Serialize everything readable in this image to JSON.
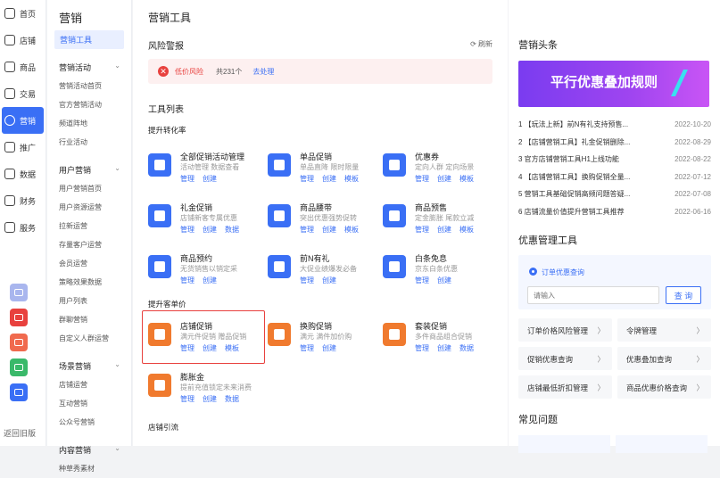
{
  "nav": {
    "items": [
      {
        "label": "首页"
      },
      {
        "label": "店铺"
      },
      {
        "label": "商品"
      },
      {
        "label": "交易"
      },
      {
        "label": "营销"
      },
      {
        "label": "推广"
      },
      {
        "label": "数据"
      },
      {
        "label": "财务"
      },
      {
        "label": "服务"
      }
    ],
    "back": "返回旧版"
  },
  "apps": [
    {
      "name": "chart-app-icon",
      "color": "#a9b6ee"
    },
    {
      "name": "video-app-icon",
      "color": "#e8413e"
    },
    {
      "name": "card-app-icon",
      "color": "#f06a4e"
    },
    {
      "name": "mail-app-icon",
      "color": "#3ab96a"
    },
    {
      "name": "grid-app-icon",
      "color": "#3a6ff5"
    }
  ],
  "sub": {
    "title": "营销",
    "selected": "营销工具",
    "groups": [
      {
        "title": "营销活动",
        "items": [
          "营销活动首页",
          "官方营销活动",
          "频道阵地",
          "行业活动"
        ]
      },
      {
        "title": "用户营销",
        "items": [
          "用户营销首页",
          "用户资源运营",
          "拉新运营",
          "存量客户运营",
          "会员运营",
          "策略效果数据",
          "用户列表",
          "群聊营销",
          "自定义人群运营"
        ]
      },
      {
        "title": "场景营销",
        "items": [
          "店铺运营",
          "互动营销",
          "公众号营销"
        ]
      },
      {
        "title": "内容营销",
        "items": [
          "种草秀素材"
        ]
      }
    ]
  },
  "main": {
    "title": "营销工具",
    "risk_title": "风险警报",
    "refresh": "刷新",
    "risk": {
      "icon": "✕",
      "label": "低价风险",
      "count": "共231个",
      "action": "去处理"
    },
    "tools_title": "工具列表"
  },
  "categories": [
    {
      "label": "提升转化率"
    },
    {
      "label": "提升客单价"
    },
    {
      "label": "店铺引流"
    }
  ],
  "tools": [
    {
      "name": "全部促销活动管理",
      "desc": "活动管理 数据查看",
      "actions": [
        "管理",
        "创建"
      ],
      "color": "#3a6ff5"
    },
    {
      "name": "单品促销",
      "desc": "单品直降 限时限量",
      "actions": [
        "管理",
        "创建",
        "模板"
      ],
      "color": "#3a6ff5"
    },
    {
      "name": "优惠券",
      "desc": "定向人群 定向场景",
      "actions": [
        "管理",
        "创建",
        "模板"
      ],
      "color": "#3a6ff5"
    },
    {
      "name": "礼金促销",
      "desc": "店铺新客专属优惠",
      "actions": [
        "管理",
        "创建",
        "数据"
      ],
      "color": "#3a6ff5"
    },
    {
      "name": "商品腰带",
      "desc": "突出优惠强势促转",
      "actions": [
        "管理",
        "创建",
        "模板"
      ],
      "color": "#3a6ff5"
    },
    {
      "name": "商品预售",
      "desc": "定金膨胀 尾款立减",
      "actions": [
        "管理",
        "创建",
        "模板"
      ],
      "color": "#3a6ff5"
    },
    {
      "name": "商品预约",
      "desc": "无货销售以销定采",
      "actions": [
        "管理",
        "创建"
      ],
      "color": "#3a6ff5"
    },
    {
      "name": "前N有礼",
      "desc": "大促业绩爆发必备",
      "actions": [
        "管理",
        "创建"
      ],
      "color": "#3a6ff5"
    },
    {
      "name": "白条免息",
      "desc": "京东白条优惠",
      "actions": [
        "管理",
        "创建"
      ],
      "color": "#3a6ff5"
    },
    {
      "name": "店铺促销",
      "desc": "满元件促销 赠品促销",
      "actions": [
        "管理",
        "创建",
        "模板"
      ],
      "color": "#f07a2e"
    },
    {
      "name": "换购促销",
      "desc": "满元 满件加价购",
      "actions": [
        "管理",
        "创建"
      ],
      "color": "#f07a2e"
    },
    {
      "name": "套装促销",
      "desc": "多件商品组合促销",
      "actions": [
        "管理",
        "创建",
        "数据"
      ],
      "color": "#f07a2e"
    },
    {
      "name": "膨胀金",
      "desc": "提前充值锁定未来消费",
      "actions": [
        "管理",
        "创建",
        "数据"
      ],
      "color": "#f07a2e"
    }
  ],
  "right": {
    "headline_title": "营销头条",
    "banner_text": "平行优惠叠加规则",
    "news": [
      {
        "title": "1 【玩法上新】前N有礼支持预售...",
        "date": "2022-10-20"
      },
      {
        "title": "2 【店铺营销工具】礼金促销删除...",
        "date": "2022-08-29"
      },
      {
        "title": "3 官方店铺营销工具H1上线功能",
        "date": "2022-08-22"
      },
      {
        "title": "4 【店铺营销工具】换购促销全量...",
        "date": "2022-07-12"
      },
      {
        "title": "5 营销工具基础促销高频问题答疑...",
        "date": "2022-07-08"
      },
      {
        "title": "6 店铺流量价值提升营销工具推荐",
        "date": "2022-06-16"
      }
    ],
    "mgmt_title": "优惠管理工具",
    "radio_label": "订单优惠查询",
    "input_placeholder": "请输入",
    "query_btn": "查 询",
    "mgmt_links": [
      "订单价格风险管理",
      "令牌管理",
      "促销优惠查询",
      "优惠叠加查询",
      "店铺最低折扣管理",
      "商品优惠价格查询"
    ],
    "chevron": "〉",
    "faq_title": "常见问题"
  }
}
